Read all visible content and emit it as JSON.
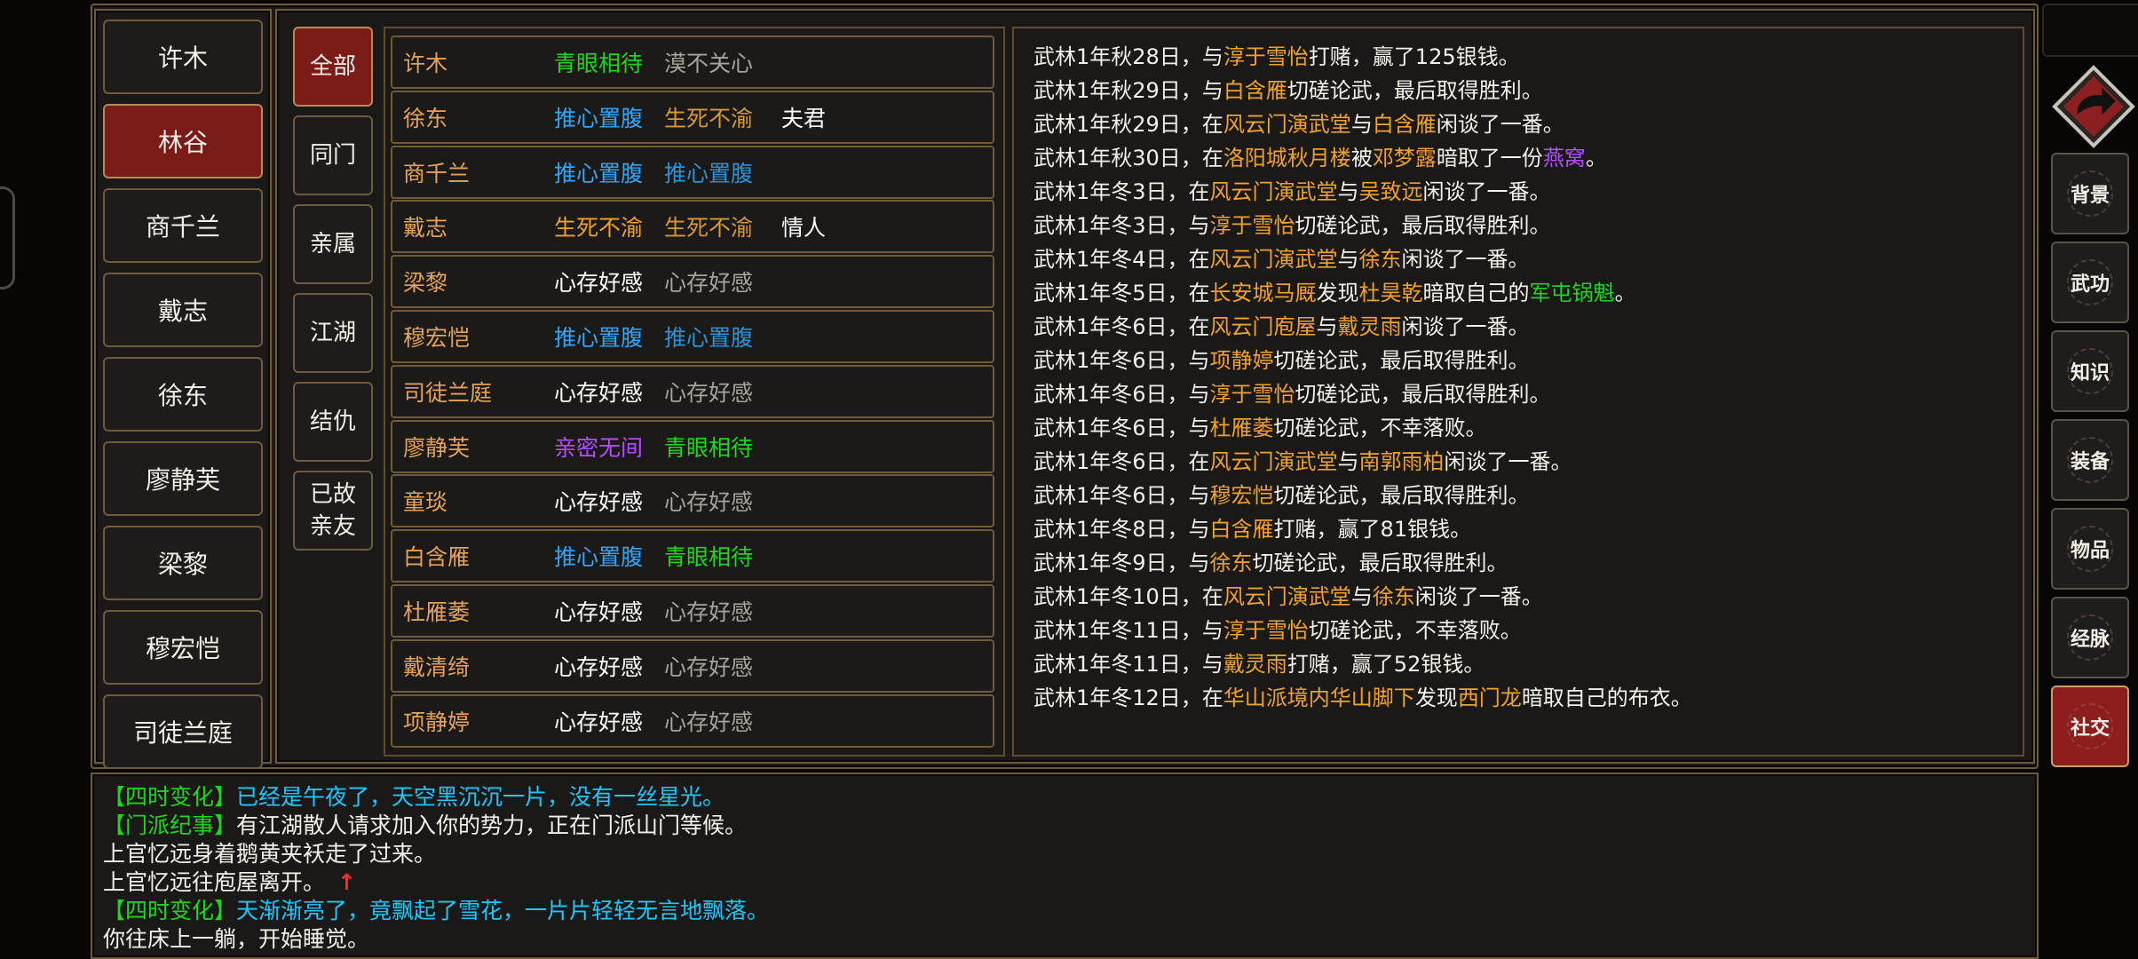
{
  "colors": {
    "orange": "#f0a22a",
    "gold": "#d59a35",
    "blue": "#2fa7ff",
    "green": "#1ed61e",
    "purple": "#b44cff",
    "gray": "#a8a39a",
    "white": "#ffffff",
    "cyan": "#1ec8ff",
    "red": "#ff2a2a",
    "frame": "#6f5b37",
    "panel": "#1b1a18",
    "active_red": "#7a1b18"
  },
  "characters": [
    "许木",
    "林谷",
    "商千兰",
    "戴志",
    "徐东",
    "廖静芙",
    "梁黎",
    "穆宏恺",
    "司徒兰庭"
  ],
  "active_character": "林谷",
  "categories": [
    {
      "label": "全部"
    },
    {
      "label": "同门"
    },
    {
      "label": "亲属"
    },
    {
      "label": "江湖"
    },
    {
      "label": "结仇"
    },
    {
      "label": "已故亲友"
    }
  ],
  "relations": [
    {
      "name": "许木",
      "a": "青眼相待",
      "a_color": "green",
      "b": "漠不关心",
      "b_color": "gray",
      "c": ""
    },
    {
      "name": "徐东",
      "a": "推心置腹",
      "a_color": "blue",
      "b": "生死不渝",
      "b_color": "gold",
      "c": "夫君"
    },
    {
      "name": "商千兰",
      "a": "推心置腹",
      "a_color": "blue",
      "b": "推心置腹",
      "b_color": "blue_dim",
      "c": ""
    },
    {
      "name": "戴志",
      "a": "生死不渝",
      "a_color": "orange",
      "b": "生死不渝",
      "b_color": "gold",
      "c": "情人"
    },
    {
      "name": "梁黎",
      "a": "心存好感",
      "a_color": "white",
      "b": "心存好感",
      "b_color": "gray",
      "c": ""
    },
    {
      "name": "穆宏恺",
      "a": "推心置腹",
      "a_color": "blue",
      "b": "推心置腹",
      "b_color": "blue_dim",
      "c": ""
    },
    {
      "name": "司徒兰庭",
      "a": "心存好感",
      "a_color": "white",
      "b": "心存好感",
      "b_color": "gray",
      "c": ""
    },
    {
      "name": "廖静芙",
      "a": "亲密无间",
      "a_color": "purple",
      "b": "青眼相待",
      "b_color": "green",
      "c": ""
    },
    {
      "name": "童琰",
      "a": "心存好感",
      "a_color": "white",
      "b": "心存好感",
      "b_color": "gray",
      "c": ""
    },
    {
      "name": "白含雁",
      "a": "推心置腹",
      "a_color": "blue",
      "b": "青眼相待",
      "b_color": "green",
      "c": ""
    },
    {
      "name": "杜雁萎",
      "a": "心存好感",
      "a_color": "white",
      "b": "心存好感",
      "b_color": "gray",
      "c": ""
    },
    {
      "name": "戴清绮",
      "a": "心存好感",
      "a_color": "white",
      "b": "心存好感",
      "b_color": "gray",
      "c": ""
    },
    {
      "name": "项静婷",
      "a": "心存好感",
      "a_color": "white",
      "b": "心存好感",
      "b_color": "gray",
      "c": ""
    }
  ],
  "event_log": [
    [
      [
        "武林1年秋28日，与",
        "w"
      ],
      [
        "淳于雪怡",
        "o"
      ],
      [
        "打赌，赢了125银钱。",
        "w"
      ]
    ],
    [
      [
        "武林1年秋29日，与",
        "w"
      ],
      [
        "白含雁",
        "o"
      ],
      [
        "切磋论武，最后取得胜利。",
        "w"
      ]
    ],
    [
      [
        "武林1年秋29日，在",
        "w"
      ],
      [
        "风云门演武堂",
        "o"
      ],
      [
        "与",
        "w"
      ],
      [
        "白含雁",
        "o"
      ],
      [
        "闲谈了一番。",
        "w"
      ]
    ],
    [
      [
        "武林1年秋30日，在",
        "w"
      ],
      [
        "洛阳城秋月楼",
        "o"
      ],
      [
        "被",
        "w"
      ],
      [
        "邓梦露",
        "o"
      ],
      [
        "暗取了一份",
        "w"
      ],
      [
        "燕窝",
        "p"
      ],
      [
        "。",
        "w"
      ]
    ],
    [
      [
        "武林1年冬3日，在",
        "w"
      ],
      [
        "风云门演武堂",
        "o"
      ],
      [
        "与",
        "w"
      ],
      [
        "吴致远",
        "o"
      ],
      [
        "闲谈了一番。",
        "w"
      ]
    ],
    [
      [
        "武林1年冬3日，与",
        "w"
      ],
      [
        "淳于雪怡",
        "o"
      ],
      [
        "切磋论武，最后取得胜利。",
        "w"
      ]
    ],
    [
      [
        "武林1年冬4日，在",
        "w"
      ],
      [
        "风云门演武堂",
        "o"
      ],
      [
        "与",
        "w"
      ],
      [
        "徐东",
        "o"
      ],
      [
        "闲谈了一番。",
        "w"
      ]
    ],
    [
      [
        "武林1年冬5日，在",
        "w"
      ],
      [
        "长安城马厩",
        "o"
      ],
      [
        "发现",
        "w"
      ],
      [
        "杜昊乾",
        "o"
      ],
      [
        "暗取自己的",
        "w"
      ],
      [
        "军屯锅魁",
        "g"
      ],
      [
        "。",
        "w"
      ]
    ],
    [
      [
        "武林1年冬6日，在",
        "w"
      ],
      [
        "风云门庖屋",
        "o"
      ],
      [
        "与",
        "w"
      ],
      [
        "戴灵雨",
        "o"
      ],
      [
        "闲谈了一番。",
        "w"
      ]
    ],
    [
      [
        "武林1年冬6日，与",
        "w"
      ],
      [
        "项静婷",
        "o"
      ],
      [
        "切磋论武，最后取得胜利。",
        "w"
      ]
    ],
    [
      [
        "武林1年冬6日，与",
        "w"
      ],
      [
        "淳于雪怡",
        "o"
      ],
      [
        "切磋论武，最后取得胜利。",
        "w"
      ]
    ],
    [
      [
        "武林1年冬6日，与",
        "w"
      ],
      [
        "杜雁萎",
        "o"
      ],
      [
        "切磋论武，不幸落败。",
        "w"
      ]
    ],
    [
      [
        "武林1年冬6日，在",
        "w"
      ],
      [
        "风云门演武堂",
        "o"
      ],
      [
        "与",
        "w"
      ],
      [
        "南郭雨柏",
        "o"
      ],
      [
        "闲谈了一番。",
        "w"
      ]
    ],
    [
      [
        "武林1年冬6日，与",
        "w"
      ],
      [
        "穆宏恺",
        "o"
      ],
      [
        "切磋论武，最后取得胜利。",
        "w"
      ]
    ],
    [
      [
        "武林1年冬8日，与",
        "w"
      ],
      [
        "白含雁",
        "o"
      ],
      [
        "打赌，赢了81银钱。",
        "w"
      ]
    ],
    [
      [
        "武林1年冬9日，与",
        "w"
      ],
      [
        "徐东",
        "o"
      ],
      [
        "切磋论武，最后取得胜利。",
        "w"
      ]
    ],
    [
      [
        "武林1年冬10日，在",
        "w"
      ],
      [
        "风云门演武堂",
        "o"
      ],
      [
        "与",
        "w"
      ],
      [
        "徐东",
        "o"
      ],
      [
        "闲谈了一番。",
        "w"
      ]
    ],
    [
      [
        "武林1年冬11日，与",
        "w"
      ],
      [
        "淳于雪怡",
        "o"
      ],
      [
        "切磋论武，不幸落败。",
        "w"
      ]
    ],
    [
      [
        "武林1年冬11日，与",
        "w"
      ],
      [
        "戴灵雨",
        "o"
      ],
      [
        "打赌，赢了52银钱。",
        "w"
      ]
    ],
    [
      [
        "武林1年冬12日，在",
        "w"
      ],
      [
        "华山派境内华山脚下",
        "o"
      ],
      [
        "发现",
        "w"
      ],
      [
        "西门龙",
        "o"
      ],
      [
        "暗取自己的布衣。",
        "w"
      ]
    ]
  ],
  "messages": [
    [
      [
        "【四时变化】",
        "g"
      ],
      [
        "已经是午夜了，天空黑沉沉一片，没有一丝星光。",
        "c"
      ]
    ],
    [
      [
        "【门派纪事】",
        "g"
      ],
      [
        "有江湖散人请求加入你的势力，正在门派山门等候。",
        "w"
      ]
    ],
    [
      [
        "上官忆远身着鹅黄夹袄走了过来。",
        "w"
      ]
    ],
    [
      [
        "上官忆远往庖屋离开。",
        "w"
      ],
      [
        "↑",
        "r"
      ]
    ],
    [
      [
        "【四时变化】",
        "g"
      ],
      [
        "天渐渐亮了，竟飘起了雪花，一片片轻轻无言地飘落。",
        "c"
      ]
    ],
    [
      [
        "你往床上一躺，开始睡觉。",
        "w"
      ]
    ]
  ],
  "side_menu": [
    "背景",
    "武功",
    "知识",
    "装备",
    "物品",
    "经脉",
    "社交"
  ],
  "active_side": "社交",
  "back_icon": "return-arrow-icon"
}
